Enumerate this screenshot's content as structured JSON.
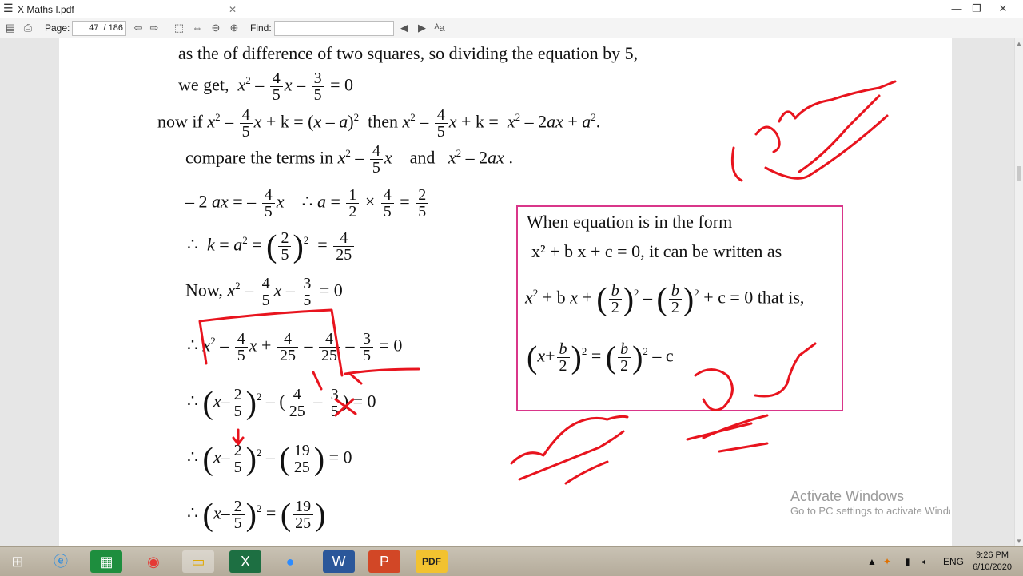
{
  "window": {
    "tab_title": "X Maths I.pdf",
    "tab_close": "✕",
    "minimize": "—",
    "restore": "❐",
    "close": "✕"
  },
  "toolbar": {
    "page_label": "Page:",
    "page_current": "47",
    "page_total": "/ 186",
    "find_label": "Find:",
    "find_value": "",
    "icons": [
      "open-icon",
      "print-icon",
      "back-icon",
      "forward-icon",
      "fit-page-icon",
      "fit-width-icon",
      "zoom-out-icon",
      "zoom-in-icon",
      "prev-match-icon",
      "next-match-icon",
      "match-case-icon"
    ]
  },
  "content": {
    "l1": "as the of difference of two squares, so dividing the equation by 5,",
    "l2_prefix": "we get,",
    "l3_prefix": "now if",
    "l3_then": "then",
    "l4_prefix": "compare the terms in",
    "l4_and": "and",
    "l7_prefix": "Now,"
  },
  "box": {
    "b1": "When   equation   is   in   the   form",
    "b2": "x² + b x + c = 0, it can be written as",
    "b3_suffix": "+ c = 0 that is,",
    "b4_suffix": "– c"
  },
  "watermark": {
    "line1": "Activate Windows",
    "line2": "Go to PC settings to activate Windows."
  },
  "taskbar": {
    "lang": "ENG",
    "time": "9:26 PM",
    "date": "6/10/2020"
  },
  "colors": {
    "ink": "#e8141e",
    "box_border": "#d9368a"
  }
}
